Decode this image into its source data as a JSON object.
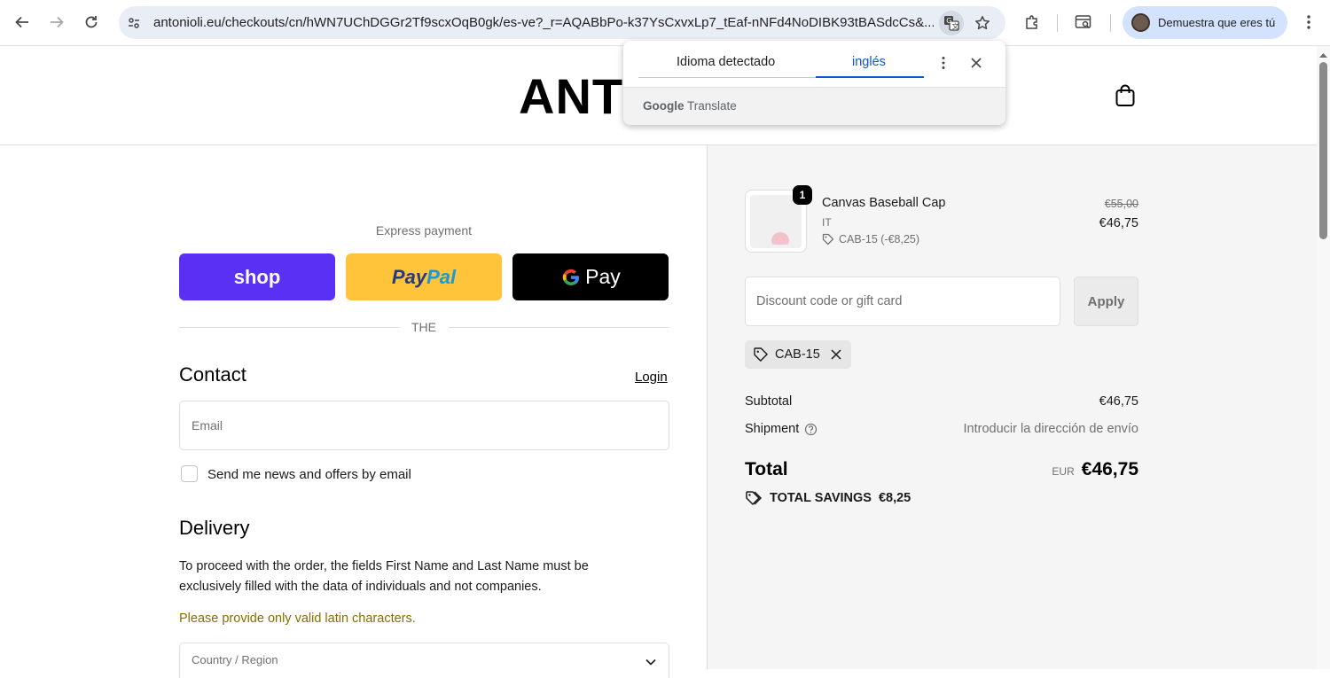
{
  "browser": {
    "url": "antonioli.eu/checkouts/cn/hWN7UChDGGr2Tf9scxOqB0gk/es-ve?_r=AQABbPo-k37YsCxvxLp7_tEaf-nNFd4NoDIBK93tBASdcCs&...",
    "profile_label": "Demuestra que eres tú"
  },
  "translate_popup": {
    "tab_detected": "Idioma detectado",
    "tab_target": "inglés",
    "brand_google": "Google",
    "brand_translate": "Translate"
  },
  "header": {
    "logo": "ANTONIOLI"
  },
  "express": {
    "label": "Express payment",
    "shop": "shop",
    "paypal": "PayPal",
    "gpay": "G Pay",
    "or_text": "THE"
  },
  "contact": {
    "title": "Contact",
    "login": "Login",
    "email_placeholder": "Email",
    "newsletter_label": "Send me news and offers by email"
  },
  "delivery": {
    "title": "Delivery",
    "notice": "To proceed with the order, the fields First Name and Last Name must be exclusively filled with the data of individuals and not companies.",
    "warning": "Please provide only valid latin characters.",
    "country_label": "Country / Region"
  },
  "summary": {
    "product": {
      "quantity": "1",
      "name": "Canvas Baseball Cap",
      "variant": "IT",
      "discount": "CAB-15 (-€8,25)",
      "old_price": "€55,00",
      "price": "€46,75"
    },
    "discount_placeholder": "Discount code or gift card",
    "apply": "Apply",
    "applied_code": "CAB-15",
    "subtotal_label": "Subtotal",
    "subtotal_value": "€46,75",
    "shipment_label": "Shipment",
    "shipment_value": "Introducir la dirección de envío",
    "total_label": "Total",
    "total_currency": "EUR",
    "total_value": "€46,75",
    "savings_label": "TOTAL SAVINGS",
    "savings_value": "€8,25"
  }
}
